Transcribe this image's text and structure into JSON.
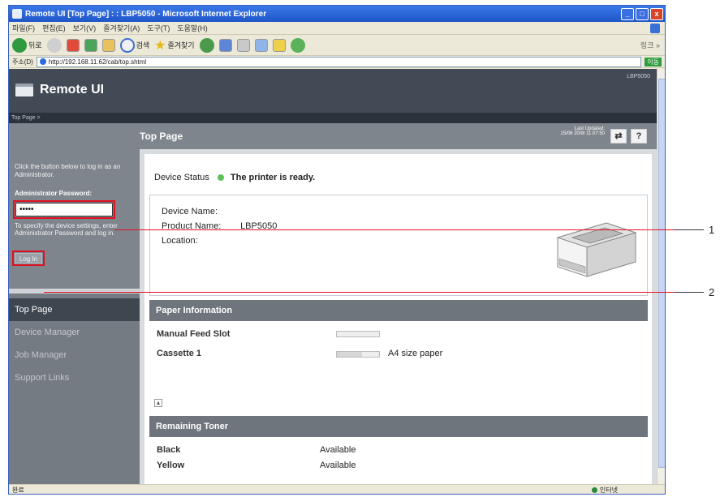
{
  "window": {
    "title": "Remote UI [Top Page] : : LBP5050 - Microsoft Internet Explorer",
    "controls": [
      "_",
      "□",
      "x"
    ]
  },
  "menubar": [
    "파일(F)",
    "편집(E)",
    "보기(V)",
    "즐겨찾기(A)",
    "도구(T)",
    "도움말(H)"
  ],
  "toolbar": {
    "back": "뒤로",
    "search": "검색",
    "favorites": "즐겨찾기",
    "tail": "링크 »"
  },
  "addressbar": {
    "label": "주소(D)",
    "url": "http://192.168.11.62/cab/top.shtml",
    "go": "이동"
  },
  "remote_ui": {
    "logo": "Remote UI",
    "model": "LBP5050",
    "breadcrumb": "Top Page >",
    "page_title": "Top Page",
    "last_updated_label": "Last Updated:",
    "last_updated_value": "15/06 2008 11:07:50",
    "refresh_btn": "⇄",
    "help_btn": "?"
  },
  "login": {
    "help": "Click the button below to log in as an Administrator.",
    "password_label": "Administrator Password:",
    "password_value": "•••••",
    "spec_help": "To specify the device settings, enter Administrator Password and log in.",
    "button": "Log In"
  },
  "nav": [
    "Top Page",
    "Device Manager",
    "Job Manager",
    "Support Links"
  ],
  "device": {
    "status_label": "Device Status",
    "status_text": "The printer is ready.",
    "status_color": "#5ec25a",
    "name_label": "Device Name:",
    "name_value": "",
    "product_label": "Product Name:",
    "product_value": "LBP5050",
    "location_label": "Location:",
    "location_value": ""
  },
  "paper": {
    "heading": "Paper Information",
    "rows": [
      {
        "label": "Manual Feed Slot",
        "level": 0,
        "size": ""
      },
      {
        "label": "Cassette 1",
        "level": 0.6,
        "size": "A4 size paper"
      }
    ]
  },
  "toner": {
    "heading": "Remaining Toner",
    "rows": [
      {
        "label": "Black",
        "value": "Available"
      },
      {
        "label": "Yellow",
        "value": "Available"
      }
    ]
  },
  "callouts": [
    "1",
    "2"
  ],
  "statusbar": {
    "left": "완료",
    "zone": "인터넷"
  }
}
